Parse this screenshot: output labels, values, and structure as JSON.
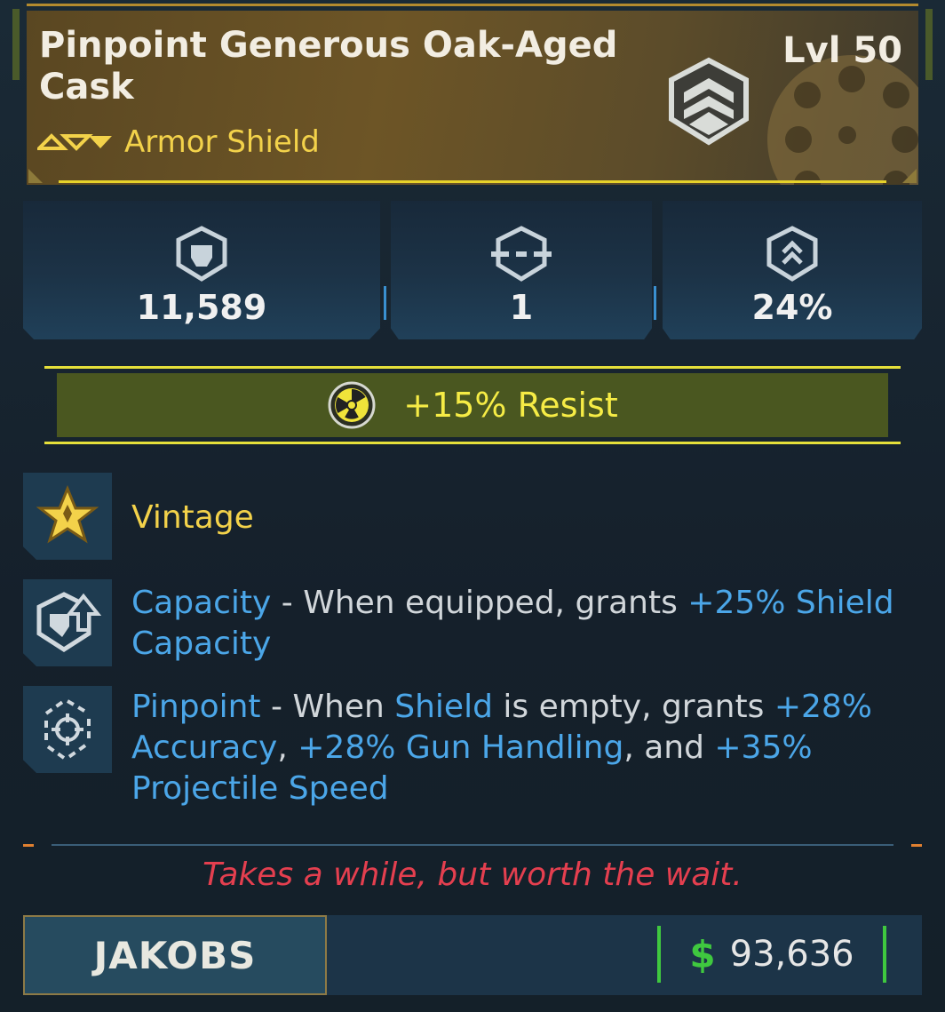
{
  "item": {
    "name": "Pinpoint Generous Oak-Aged Cask",
    "level": "Lvl 50",
    "type": "Armor Shield",
    "rarity_color": "#f3d24a"
  },
  "stats": [
    {
      "icon": "shield-capacity-icon",
      "value": "11,589"
    },
    {
      "icon": "recharge-delay-icon",
      "value": "1"
    },
    {
      "icon": "armor-segment-icon",
      "value": "24%"
    }
  ],
  "element": {
    "icon": "radiation-icon",
    "text": "+15% Resist",
    "color": "#f6ec45"
  },
  "perks": {
    "vintage": {
      "label": "Vintage"
    },
    "capacity": {
      "name": "Capacity",
      "sep": " - ",
      "t1": "When equipped, grants ",
      "h1": "+25% Shield Capacity"
    },
    "pinpoint": {
      "name": "Pinpoint",
      "sep": " - ",
      "t1": "When ",
      "h1": "Shield",
      "t2": " is empty, grants ",
      "h2": "+28% Accuracy",
      "t3": ", ",
      "h3": "+28% Gun Handling",
      "t4": ", and ",
      "h4": "+35% Projectile Speed"
    }
  },
  "flavor": "Takes a while, but worth the wait.",
  "manufacturer": "JAKOBS",
  "price": {
    "currency": "$",
    "value": "93,636",
    "color": "#3fc83f"
  }
}
